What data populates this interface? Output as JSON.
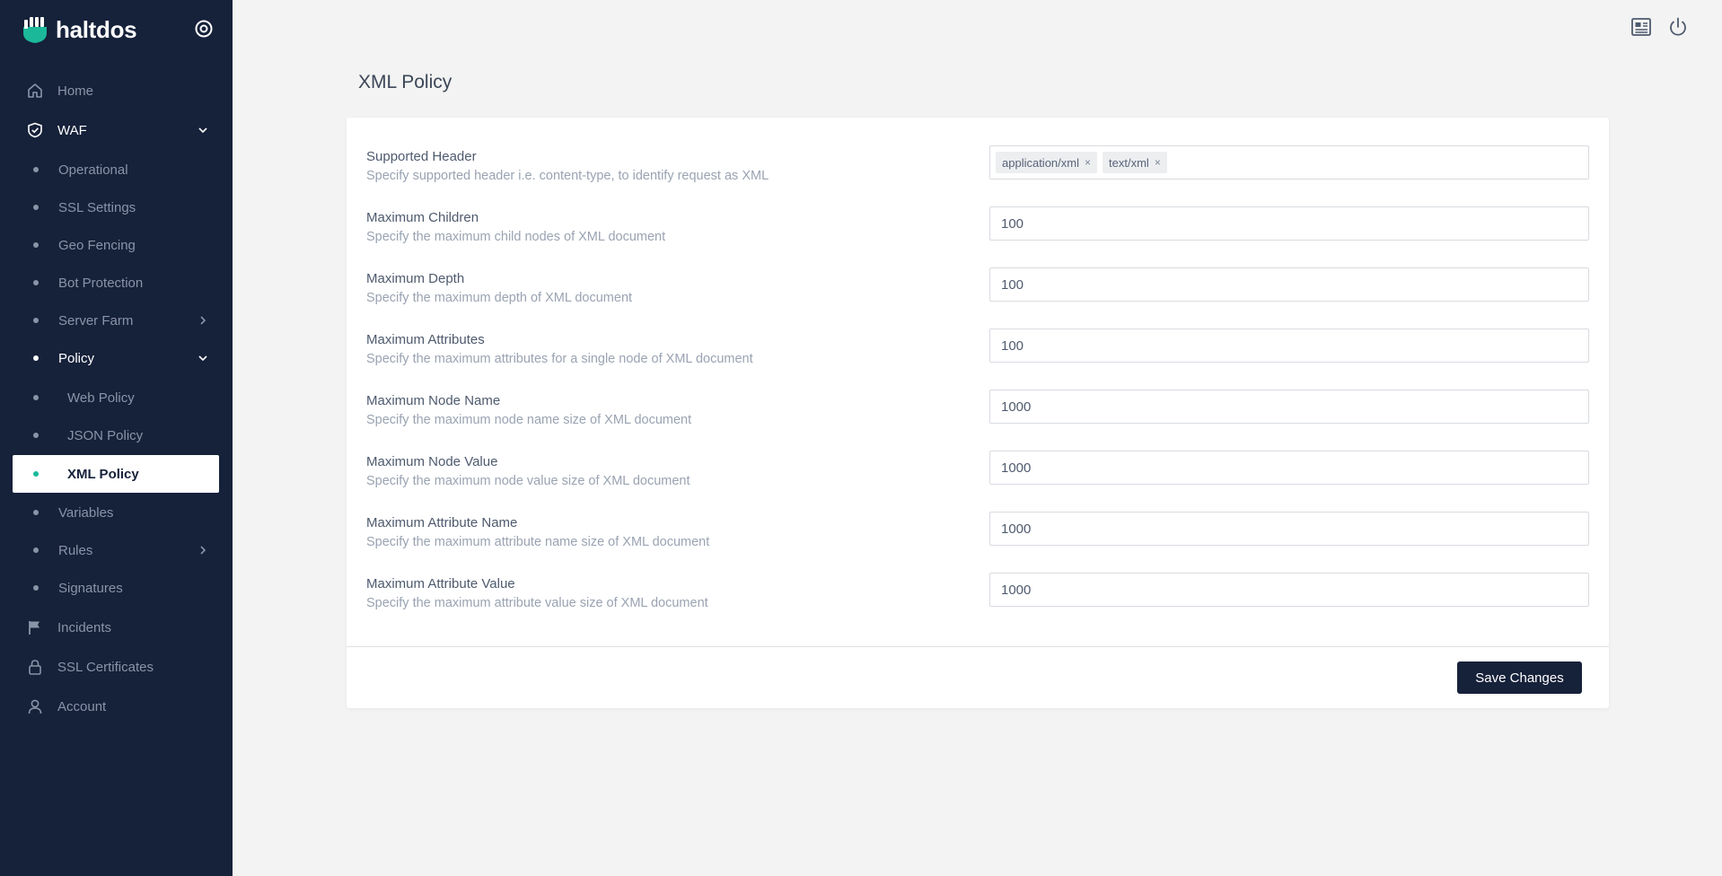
{
  "brand": {
    "name": "haltdos"
  },
  "sidebar": {
    "items": [
      {
        "label": "Home",
        "icon": "home-icon"
      },
      {
        "label": "WAF",
        "icon": "shield-check-icon"
      },
      {
        "label": "Operational"
      },
      {
        "label": "SSL Settings"
      },
      {
        "label": "Geo Fencing"
      },
      {
        "label": "Bot Protection"
      },
      {
        "label": "Server Farm"
      },
      {
        "label": "Policy"
      },
      {
        "label": "Web Policy"
      },
      {
        "label": "JSON Policy"
      },
      {
        "label": "XML Policy"
      },
      {
        "label": "Variables"
      },
      {
        "label": "Rules"
      },
      {
        "label": "Signatures"
      },
      {
        "label": "Incidents",
        "icon": "flag-icon"
      },
      {
        "label": "SSL Certificates",
        "icon": "lock-icon"
      },
      {
        "label": "Account",
        "icon": "user-icon"
      }
    ]
  },
  "page": {
    "title": "XML Policy"
  },
  "form": {
    "fields": [
      {
        "label": "Supported Header",
        "description": "Specify supported header i.e. content-type, to identify request as XML",
        "tags": [
          "application/xml",
          "text/xml"
        ]
      },
      {
        "label": "Maximum Children",
        "description": "Specify the maximum child nodes of XML document",
        "value": "100"
      },
      {
        "label": "Maximum Depth",
        "description": "Specify the maximum depth of XML document",
        "value": "100"
      },
      {
        "label": "Maximum Attributes",
        "description": "Specify the maximum attributes for a single node of XML document",
        "value": "100"
      },
      {
        "label": "Maximum Node Name",
        "description": "Specify the maximum node name size of XML document",
        "value": "1000"
      },
      {
        "label": "Maximum Node Value",
        "description": "Specify the maximum node value size of XML document",
        "value": "1000"
      },
      {
        "label": "Maximum Attribute Name",
        "description": "Specify the maximum attribute name size of XML document",
        "value": "1000"
      },
      {
        "label": "Maximum Attribute Value",
        "description": "Specify the maximum attribute value size of XML document",
        "value": "1000"
      }
    ],
    "tag_remove_symbol": "×",
    "save_label": "Save Changes"
  },
  "colors": {
    "sidebar_bg": "#16213a",
    "accent": "#1bb99a",
    "page_bg": "#f2f3f2"
  }
}
